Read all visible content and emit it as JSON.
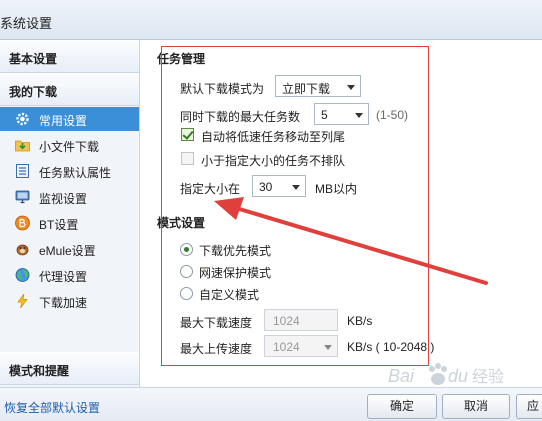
{
  "window": {
    "title": "系统设置"
  },
  "sidebar": {
    "header_basic": "基本设置",
    "header_download": "我的下载",
    "header_mode": "模式和提醒",
    "items": [
      {
        "label": "常用设置",
        "icon": "gear-icon",
        "selected": true
      },
      {
        "label": "小文件下载",
        "icon": "folder-download-icon"
      },
      {
        "label": "任务默认属性",
        "icon": "list-icon"
      },
      {
        "label": "监视设置",
        "icon": "monitor-icon"
      },
      {
        "label": "BT设置",
        "icon": "bt-icon"
      },
      {
        "label": "eMule设置",
        "icon": "emule-icon"
      },
      {
        "label": "代理设置",
        "icon": "globe-icon"
      },
      {
        "label": "下载加速",
        "icon": "lightning-icon"
      }
    ]
  },
  "task": {
    "section_title": "任务管理",
    "default_mode_label": "默认下载模式为",
    "default_mode_value": "立即下载",
    "max_tasks_label": "同时下载的最大任务数",
    "max_tasks_value": "5",
    "max_tasks_range": "(1-50)",
    "auto_move_label": "自动将低速任务移动至列尾",
    "auto_move_checked": true,
    "small_task_label": "小于指定大小的任务不排队",
    "small_task_checked": false,
    "size_label": "指定大小在",
    "size_value": "30",
    "size_unit": "MB以内"
  },
  "mode": {
    "section_title": "模式设置",
    "options": [
      "下载优先模式",
      "网速保护模式",
      "自定义模式"
    ],
    "selected_index": 0,
    "max_download_label": "最大下载速度",
    "max_download_value": "1024",
    "max_download_unit": "KB/s",
    "max_upload_label": "最大上传速度",
    "max_upload_value": "1024",
    "max_upload_unit": "KB/s ( 10-2048 )"
  },
  "footer": {
    "restore_label": "恢复全部默认设置",
    "ok_label": "确定",
    "cancel_label": "取消",
    "apply_label": "应"
  },
  "colors": {
    "accent": "#3a8fd8",
    "annotation": "#e0403b"
  }
}
